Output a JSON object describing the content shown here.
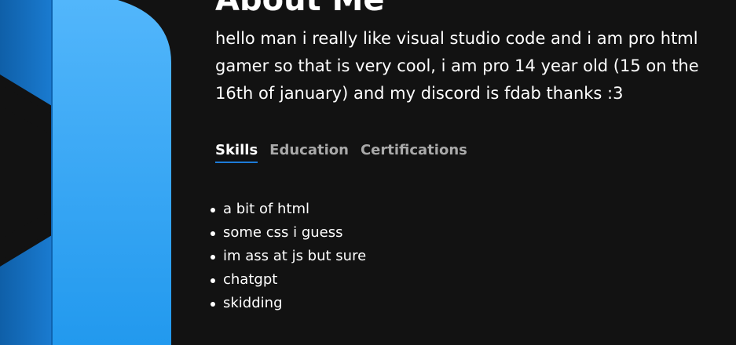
{
  "colors": {
    "background": "#121212",
    "accent_blue": "#2b9cf0",
    "tab_active_underline": "#1d7bd8",
    "tab_inactive": "#a9a9a9"
  },
  "logo": {
    "icon": "visual-studio-code-logo-icon"
  },
  "about": {
    "heading": "About Me",
    "bio": "hello man i really like visual studio code and i am pro html gamer so that is very cool, i am pro 14 year old (15 on the 16th of january) and my discord is fdab thanks :3"
  },
  "tabs": [
    {
      "label": "Skills",
      "active": true
    },
    {
      "label": "Education",
      "active": false
    },
    {
      "label": "Certifications",
      "active": false
    }
  ],
  "skills": [
    "a bit of html",
    "some css i guess",
    "im ass at js but sure",
    "chatgpt",
    "skidding"
  ]
}
